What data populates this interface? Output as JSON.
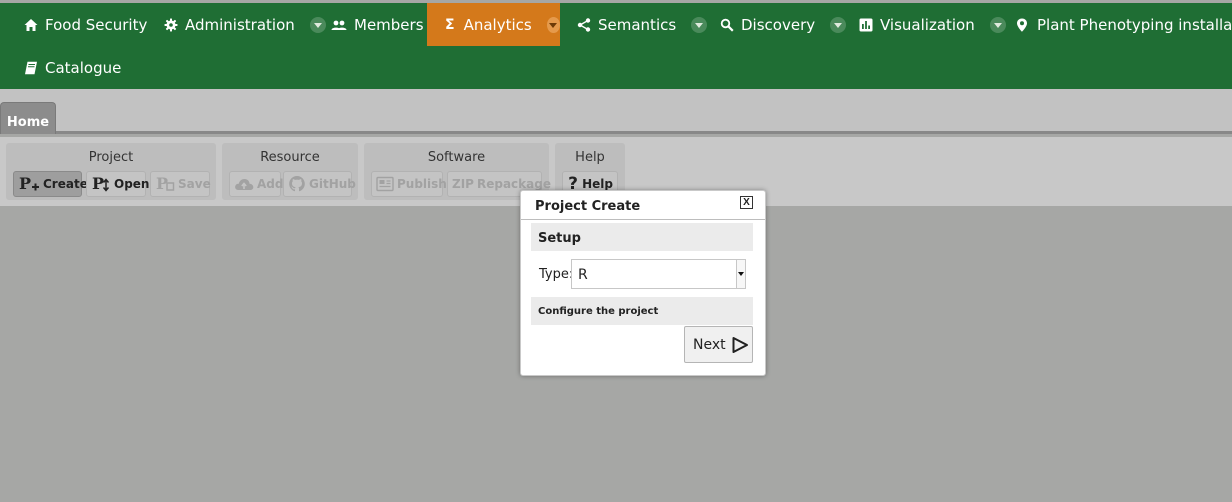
{
  "colors": {
    "nav_bg": "#1f6e34",
    "nav_active": "#d4791b",
    "page_bg": "#a6a7a5"
  },
  "nav": {
    "food_security": {
      "label": "Food Security",
      "icon": "home-icon"
    },
    "administration": {
      "label": "Administration",
      "icon": "gear-icon"
    },
    "members": {
      "label": "Members",
      "icon": "people-icon"
    },
    "analytics": {
      "label": "Analytics",
      "icon": "sigma-icon",
      "glyph": "Σ",
      "active": true
    },
    "semantics": {
      "label": "Semantics",
      "icon": "share-icon"
    },
    "discovery": {
      "label": "Discovery",
      "icon": "search-icon"
    },
    "visualization": {
      "label": "Visualization",
      "icon": "bar-chart-icon"
    },
    "plant": {
      "label": "Plant Phenotyping installations",
      "icon": "map-pin-icon"
    },
    "catalogue": {
      "label": "Catalogue",
      "icon": "book-icon"
    }
  },
  "tabs": {
    "home": "Home"
  },
  "ribbon": {
    "project": {
      "title": "Project",
      "create": {
        "label": "Create",
        "icon": "project-create-icon",
        "icon_letter": "P"
      },
      "open": {
        "label": "Open",
        "icon": "project-open-icon",
        "icon_letter": "P"
      },
      "save": {
        "label": "Save",
        "icon": "project-save-icon",
        "icon_letter": "P"
      }
    },
    "resource": {
      "title": "Resource",
      "add": {
        "label": "Add",
        "icon": "cloud-upload-icon"
      },
      "github": {
        "label": "GitHub",
        "icon": "github-icon"
      }
    },
    "software": {
      "title": "Software",
      "publish": {
        "label": "Publish",
        "icon": "publish-icon"
      },
      "repackage": {
        "label": "Repackage",
        "icon": "zip-icon",
        "icon_text": "ZIP"
      }
    },
    "help": {
      "title": "Help",
      "help": {
        "label": "Help",
        "icon": "question-icon",
        "icon_text": "?"
      }
    }
  },
  "dialog": {
    "title": "Project Create",
    "close_glyph": "X",
    "section": "Setup",
    "type_label": "Type:",
    "type_value": "R",
    "configure": "Configure the project",
    "next_label": "Next"
  }
}
